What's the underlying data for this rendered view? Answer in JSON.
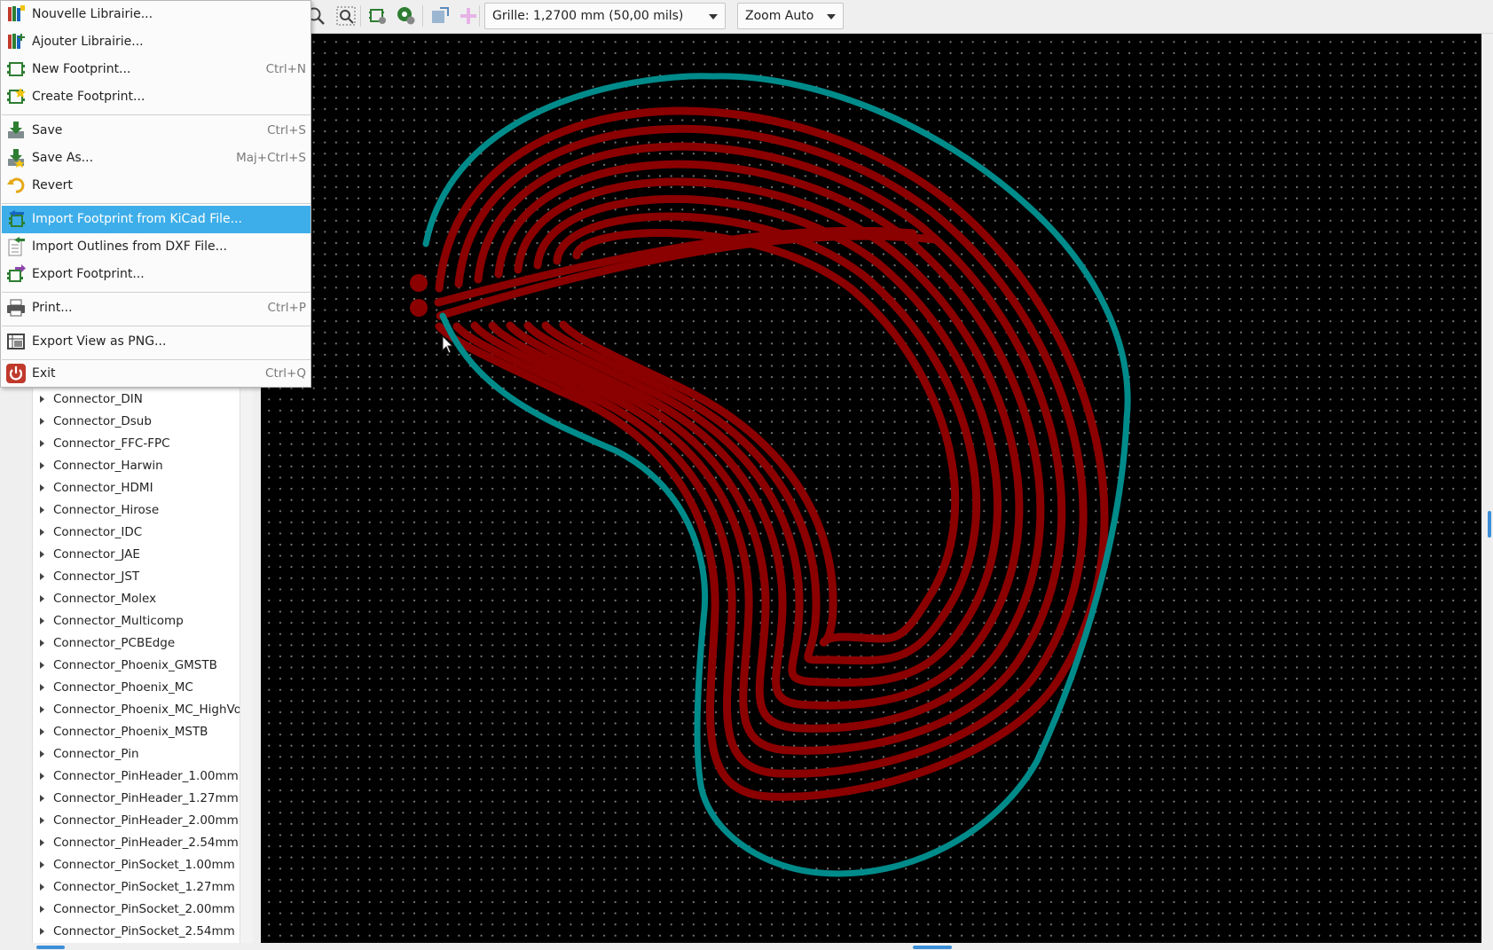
{
  "toolbar": {
    "grid": "Grille: 1,2700 mm (50,00 mils)",
    "zoom": "Zoom Auto"
  },
  "menu": {
    "items": [
      {
        "label": "Nouvelle Librairie...",
        "shortcut": "",
        "icon": "new-library-icon"
      },
      {
        "label": "Ajouter Librairie...",
        "shortcut": "",
        "icon": "add-library-icon"
      },
      {
        "label": "New Footprint...",
        "shortcut": "Ctrl+N",
        "icon": "new-footprint-icon"
      },
      {
        "label": "Create Footprint...",
        "shortcut": "",
        "icon": "create-footprint-icon"
      },
      {
        "label": "Save",
        "shortcut": "Ctrl+S",
        "icon": "save-icon"
      },
      {
        "label": "Save As...",
        "shortcut": "Maj+Ctrl+S",
        "icon": "save-as-icon"
      },
      {
        "label": "Revert",
        "shortcut": "",
        "icon": "revert-icon"
      },
      {
        "label": "Import Footprint from KiCad File...",
        "shortcut": "",
        "icon": "import-footprint-icon"
      },
      {
        "label": "Import Outlines from DXF File...",
        "shortcut": "",
        "icon": "import-dxf-icon"
      },
      {
        "label": "Export Footprint...",
        "shortcut": "",
        "icon": "export-footprint-icon"
      },
      {
        "label": "Print...",
        "shortcut": "Ctrl+P",
        "icon": "print-icon"
      },
      {
        "label": "Export View as PNG...",
        "shortcut": "",
        "icon": "export-png-icon"
      },
      {
        "label": "Exit",
        "shortcut": "Ctrl+Q",
        "icon": "exit-icon"
      }
    ],
    "highlighted": "Import Footprint from KiCad File..."
  },
  "libraries": [
    "Connector_DIN",
    "Connector_Dsub",
    "Connector_FFC-FPC",
    "Connector_Harwin",
    "Connector_HDMI",
    "Connector_Hirose",
    "Connector_IDC",
    "Connector_JAE",
    "Connector_JST",
    "Connector_Molex",
    "Connector_Multicomp",
    "Connector_PCBEdge",
    "Connector_Phoenix_GMSTB",
    "Connector_Phoenix_MC",
    "Connector_Phoenix_MC_HighVolta",
    "Connector_Phoenix_MSTB",
    "Connector_Pin",
    "Connector_PinHeader_1.00mm",
    "Connector_PinHeader_1.27mm",
    "Connector_PinHeader_2.00mm",
    "Connector_PinHeader_2.54mm",
    "Connector_PinSocket_1.00mm",
    "Connector_PinSocket_1.27mm",
    "Connector_PinSocket_2.00mm",
    "Connector_PinSocket_2.54mm"
  ],
  "colors": {
    "track": "#8b0000",
    "outline": "#008b8b",
    "highlight": "#3daee9"
  }
}
